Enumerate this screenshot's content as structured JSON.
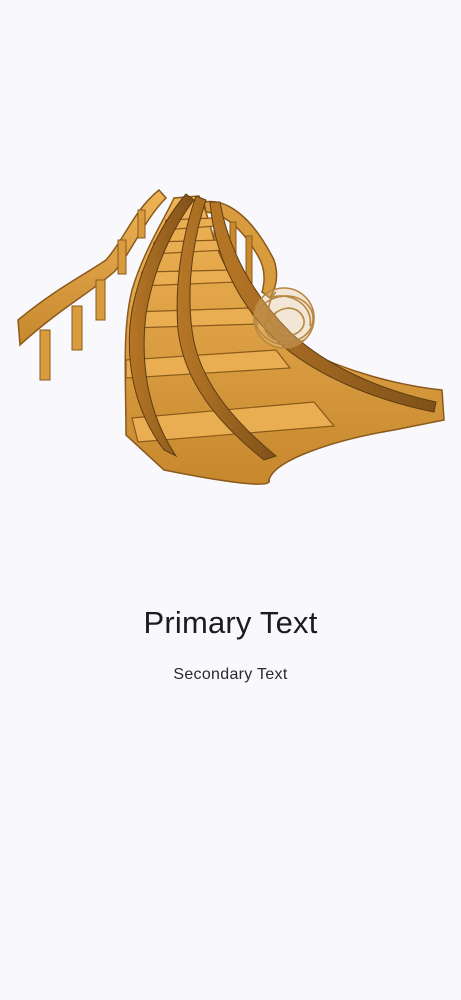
{
  "content": {
    "primary_text": "Primary Text",
    "secondary_text": "Secondary Text"
  },
  "illustration": {
    "icon": "roller-coaster-track-illustration",
    "colors": {
      "wood_light": "#e3a64a",
      "wood_mid": "#c98a2e",
      "wood_dark": "#8a5a1c",
      "tumbleweed": "#c99a55"
    }
  },
  "theme": {
    "background": "#f9f8fd",
    "text_primary": "#1c1b20",
    "text_secondary": "#2a2930"
  }
}
